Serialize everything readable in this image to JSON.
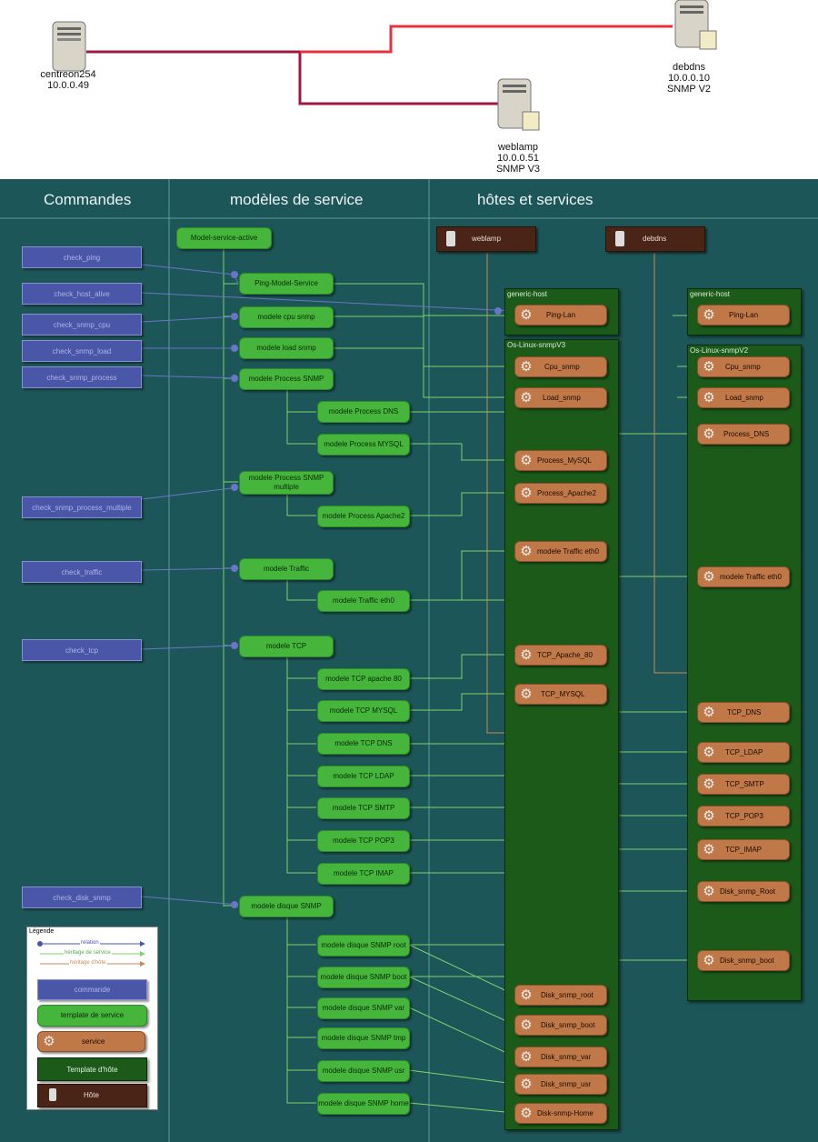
{
  "topology": {
    "nodes": [
      {
        "name": "centreon254",
        "ip": "10.0.0.49",
        "snmp": ""
      },
      {
        "name": "weblamp",
        "ip": "10.0.0.51",
        "snmp": "SNMP V3"
      },
      {
        "name": "debdns",
        "ip": "10.0.0.10",
        "snmp": "SNMP V2"
      }
    ]
  },
  "headers": {
    "commands": "Commandes",
    "models": "modèles de service",
    "hosts": "hôtes et services"
  },
  "commands": [
    "check_ping",
    "check_host_alive",
    "check_snmp_cpu",
    "check_snmp_load",
    "check_snmp_process",
    "check_snmp_process_multiple",
    "check_traffic",
    "check_tcp",
    "check_disk_snmp"
  ],
  "templates": {
    "root": "Model-service-active",
    "items": [
      "Ping-Model-Service",
      "modele cpu snmp",
      "modele load snmp",
      "modele Process SNMP",
      "modele Process DNS",
      "modele Process MYSQL",
      "modele Process SNMP multiple",
      "modele Process Apache2",
      "modele Traffic",
      "modele Traffic eth0",
      "modele TCP",
      "modele TCP apache 80",
      "modele TCP MYSQL",
      "modele TCP DNS",
      "modele TCP LDAP",
      "modele TCP SMTP",
      "modele TCP POP3",
      "modele TCP IMAP",
      "modele disque SNMP",
      "modele disque SNMP root",
      "modele disque SNMP boot",
      "modele disque SNMP var",
      "modele disque SNMP tmp",
      "modele disque SNMP usr",
      "modele disque SNMP home"
    ]
  },
  "hosts": {
    "weblamp": "weblamp",
    "debdns": "debdns"
  },
  "host_templates": {
    "generic": "generic-host",
    "v3": "Os-Linux-snmpV3",
    "v2": "Os-Linux-snmpV2"
  },
  "services_weblamp": [
    "Ping-Lan",
    "Cpu_snmp",
    "Load_snmp",
    "Process_MySQL",
    "Process_Apache2",
    "modele Traffic eth0",
    "TCP_Apache_80",
    "TCP_MYSQL",
    "Disk_snmp_root",
    "Disk_snmp_boot",
    "Disk_snmp_var",
    "Disk_snmp_usr",
    "Disk-snmp-Home"
  ],
  "services_debdns": [
    "Ping-Lan",
    "Cpu_snmp",
    "Load_snmp",
    "Process_DNS",
    "modele Traffic eth0",
    "TCP_DNS",
    "TCP_LDAP",
    "TCP_SMTP",
    "TCP_POP3",
    "TCP_IMAP",
    "Disk_snmp_Root",
    "Disk_snmp_boot"
  ],
  "legend": {
    "title": "Légende",
    "relation": "relation",
    "service_inherit": "héritage de service",
    "host_inherit": "héritage d'hôte",
    "command": "commande",
    "service_template": "template de service",
    "service": "service",
    "host_template": "Template d'hôte",
    "host": "Hôte"
  },
  "colors": {
    "background": "#1d5658",
    "command": "#4a56a8",
    "template": "#46b53c",
    "service": "#c07848",
    "host_template": "#1c5a1a",
    "host": "#4a2416",
    "relation": "#6a74c8",
    "service_inherit": "#7ed36e",
    "host_inherit": "#c98a5a",
    "link_red": "#e8303c",
    "link_dark": "#a01840"
  }
}
